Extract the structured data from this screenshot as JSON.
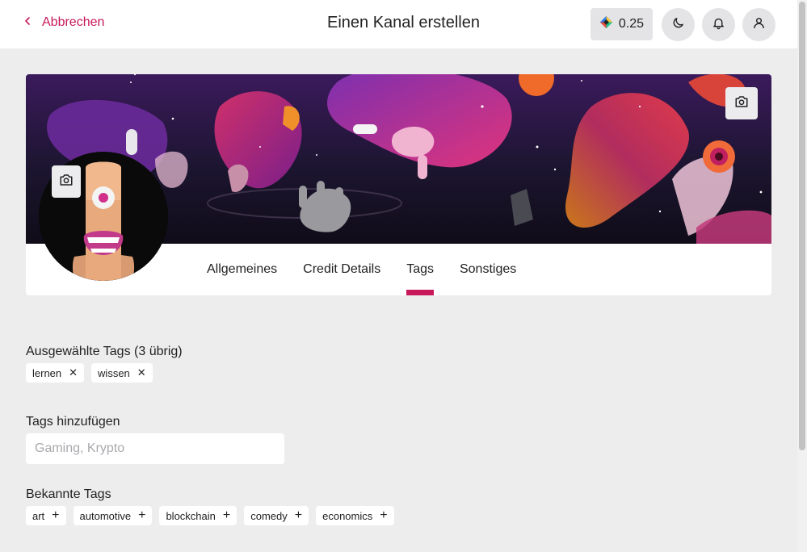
{
  "header": {
    "back_label": "Abbrechen",
    "title": "Einen Kanal erstellen",
    "credits": "0.25",
    "icons": [
      "lbc-icon",
      "moon-icon",
      "bell-icon",
      "user-icon"
    ]
  },
  "tabs": [
    {
      "label": "Allgemeines",
      "active": false
    },
    {
      "label": "Credit Details",
      "active": false
    },
    {
      "label": "Tags",
      "active": true
    },
    {
      "label": "Sonstiges",
      "active": false
    }
  ],
  "selected_tags": {
    "title": "Ausgewählte Tags (3 übrig)",
    "items": [
      "lernen",
      "wissen"
    ]
  },
  "add_tags": {
    "title": "Tags hinzufügen",
    "placeholder": "Gaming, Krypto"
  },
  "known_tags": {
    "title": "Bekannte Tags",
    "items": [
      "art",
      "automotive",
      "blockchain",
      "comedy",
      "economics"
    ]
  },
  "colors": {
    "accent": "#c7185a",
    "background": "#ededee"
  }
}
